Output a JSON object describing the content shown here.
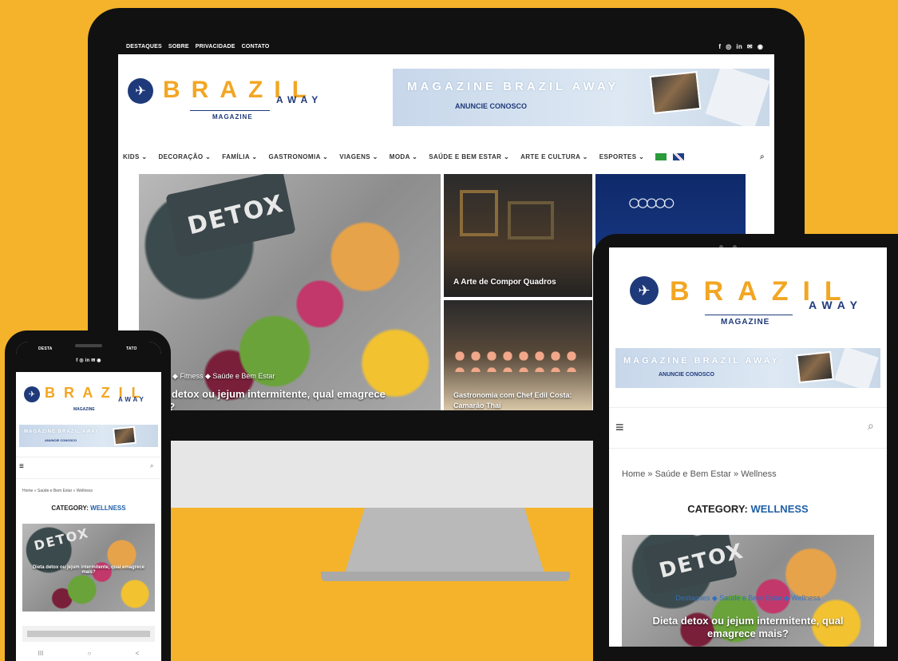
{
  "colors": {
    "background": "#F4B32A",
    "brand_blue": "#1f3a7a",
    "brand_orange": "#F2A623",
    "link_blue": "#1f5fa6"
  },
  "desktop": {
    "topbar": {
      "nav": [
        "DESTAQUES",
        "SOBRE",
        "PRIVACIDADE",
        "CONTATO"
      ],
      "social_icons": [
        "facebook-icon",
        "instagram-icon",
        "linkedin-icon",
        "mail-icon",
        "spotify-icon"
      ]
    },
    "logo": {
      "letters": [
        "B",
        "R",
        "A",
        "Z",
        "I",
        "L"
      ],
      "away": "AWAY",
      "magazine": "MAGAZINE"
    },
    "banner": {
      "title": "MAGAZINE BRAZIL AWAY",
      "cta": "ANUNCIE CONOSCO"
    },
    "menu": [
      "KIDS",
      "DECORAÇÃO",
      "FAMÍLIA",
      "GASTRONOMIA",
      "VIAGENS",
      "MODA",
      "SAÚDE E BEM ESTAR",
      "ARTE E CULTURA",
      "ESPORTES"
    ],
    "hero": {
      "main_word": "DETOX",
      "main_cats": "ques  ◆  Fitness  ◆  Saúde e Bem Estar",
      "main_title": "a detox ou jejum intermitente, qual emagrece",
      "main_title2": "s?",
      "tile1_title": "A Arte de Compor Quadros",
      "tile2_title": "Gastronomia com Chef Edil Costa:",
      "tile2_title2": "Camarão Thai"
    }
  },
  "phone": {
    "topbar": {
      "left": "DESTA",
      "right": "TATO",
      "social": "f  ◎  in  ✉  ◉"
    },
    "logo": {
      "letters": "B R A Z I L",
      "away": "AWAY",
      "magazine": "MAGAZINE"
    },
    "banner": {
      "title": "MAGAZINE BRAZIL AWAY",
      "cta": "ANUNCIE CONOSCO"
    },
    "breadcrumb": "Home » Saúde e Bem Estar » Wellness",
    "category_prefix": "CATEGORY: ",
    "category_name": "WELLNESS",
    "post_title": "Dieta detox ou jejum intermitente, qual emagrece mais?",
    "post_cats": "Destaques ◆ Saúde e Bem Estar ◆ Wellness",
    "nav_buttons": [
      "III",
      "○",
      "<"
    ]
  },
  "tablet": {
    "logo": {
      "letters": [
        "B",
        "R",
        "A",
        "Z",
        "I",
        "L"
      ],
      "away": "AWAY",
      "magazine": "MAGAZINE"
    },
    "banner": {
      "title": "MAGAZINE BRAZIL AWAY",
      "cta": "ANUNCIE CONOSCO"
    },
    "breadcrumb": "Home » Saúde e Bem Estar » Wellness",
    "category_prefix": "CATEGORY: ",
    "category_name": "WELLNESS",
    "post_cats": "Destaques  ◆  Saúde e Bem Estar  ◆  Wellness",
    "post_title": "Dieta detox ou jejum intermitente, qual",
    "post_title2": "emagrece mais?",
    "detox_word": "DETOX"
  }
}
